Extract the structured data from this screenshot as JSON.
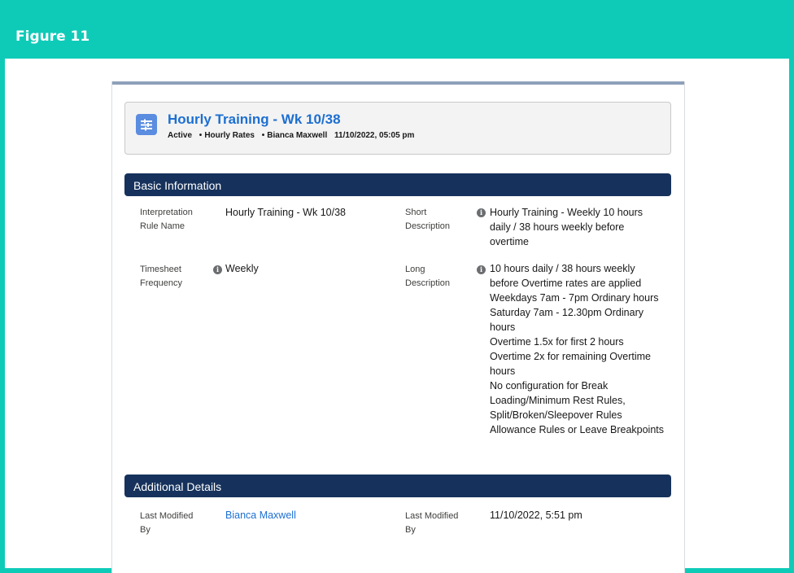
{
  "figure": {
    "title": "Figure 11"
  },
  "record": {
    "title": "Hourly Training - Wk 10/38",
    "status": "Active",
    "rate_type": "Hourly Rates",
    "owner": "Bianca Maxwell",
    "datetime": "11/10/2022, 05:05 pm",
    "icon": "rule-icon"
  },
  "basic_information": {
    "heading": "Basic Information",
    "rule_name_label": "Interpretation Rule Name",
    "rule_name_value": "Hourly Training - Wk 10/38",
    "short_desc_label": "Short Description",
    "short_desc_value": "Hourly Training - Weekly 10 hours\ndaily / 38 hours weekly before\novertime",
    "timesheet_label": "Timesheet Frequency",
    "timesheet_value": "Weekly",
    "long_desc_label": "Long Description",
    "long_desc_value": "10 hours daily / 38 hours weekly\nbefore Overtime rates are applied\nWeekdays 7am - 7pm Ordinary hours\nSaturday 7am - 12.30pm Ordinary\nhours\nOvertime 1.5x for first 2 hours\nOvertime 2x for remaining Overtime\nhours\nNo configuration for Break\nLoading/Minimum Rest Rules,\nSplit/Broken/Sleepover Rules\nAllowance Rules or Leave Breakpoints"
  },
  "additional_details": {
    "heading": "Additional Details",
    "modified_by_label": "Last Modified By",
    "modified_by_value": "Bianca Maxwell",
    "modified_date_label": "Last Modified By",
    "modified_date_value": "11/10/2022, 5:51 pm"
  },
  "colors": {
    "frame": "#0ecbb8",
    "section_bar": "#16325c",
    "link": "#1d6fd1",
    "icon_bg": "#5a8ce0"
  }
}
